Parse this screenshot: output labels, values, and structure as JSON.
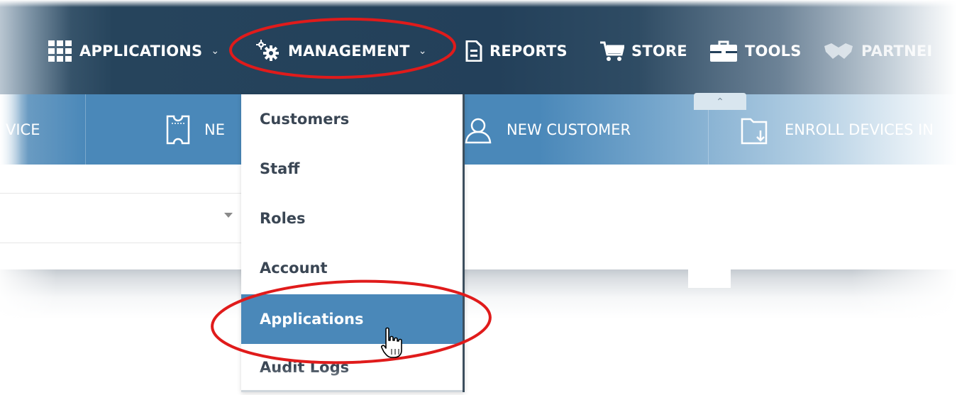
{
  "nav": {
    "items": [
      {
        "label": "APPLICATIONS",
        "icon": "grid-icon",
        "has_dropdown": true
      },
      {
        "label": "MANAGEMENT",
        "icon": "gears-icon",
        "has_dropdown": true
      },
      {
        "label": "REPORTS",
        "icon": "report-icon",
        "has_dropdown": false
      },
      {
        "label": "STORE",
        "icon": "cart-icon",
        "has_dropdown": false
      },
      {
        "label": "TOOLS",
        "icon": "toolbox-icon",
        "has_dropdown": false
      },
      {
        "label": "PARTNEI",
        "icon": "handshake-icon",
        "has_dropdown": false
      }
    ]
  },
  "toolbar": {
    "items": [
      {
        "label": "VICE"
      },
      {
        "label": "NE",
        "icon": "ticket-icon"
      },
      {
        "label": "NEW CUSTOMER",
        "icon": "user-icon"
      },
      {
        "label": "ENROLL DEVICES IN",
        "icon": "folder-download-icon"
      }
    ]
  },
  "management_menu": {
    "items": [
      {
        "label": "Customers",
        "active": false
      },
      {
        "label": "Staff",
        "active": false
      },
      {
        "label": "Roles",
        "active": false
      },
      {
        "label": "Account",
        "active": false
      },
      {
        "label": "Applications",
        "active": true
      },
      {
        "label": "Audit Logs",
        "active": false
      }
    ]
  },
  "colors": {
    "nav_bg": "#23405a",
    "toolbar_bg": "#4a88b9",
    "menu_active_bg": "#4a88b9",
    "menu_text": "#3a4654",
    "annotation_red": "#e01b1b"
  }
}
